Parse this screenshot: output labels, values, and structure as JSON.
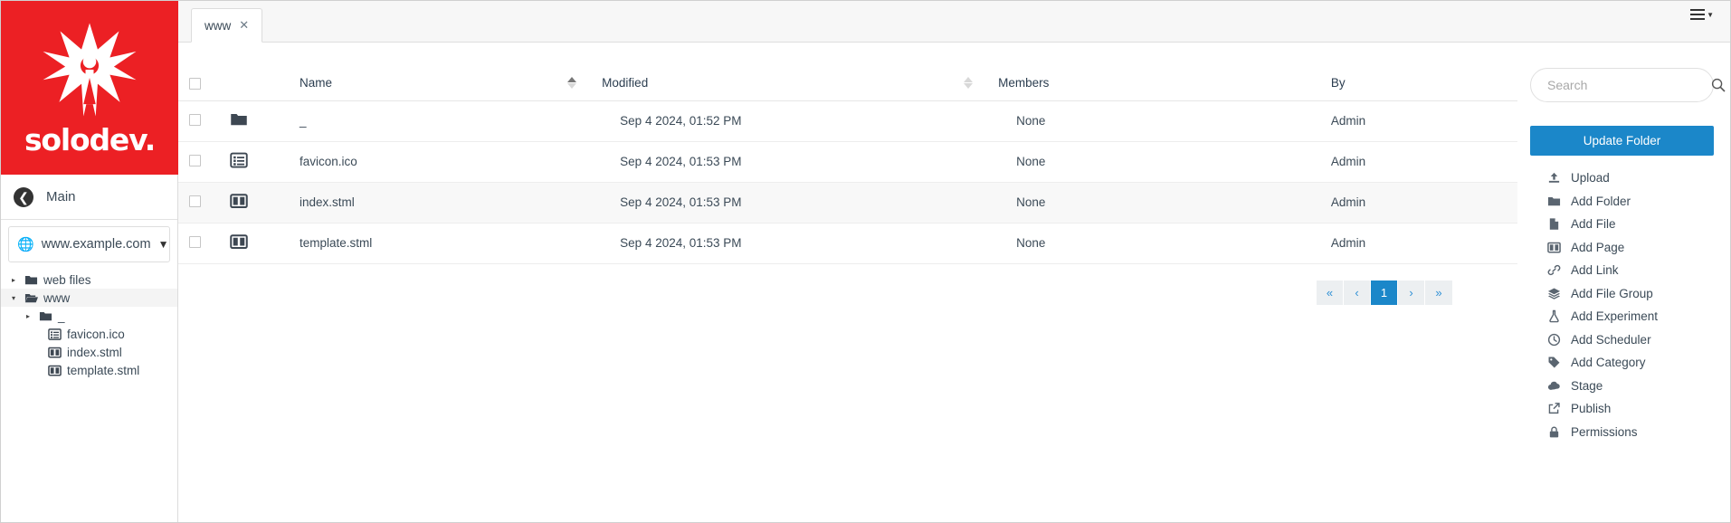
{
  "brand": {
    "name": "solodev.",
    "color": "#ec2024",
    "logo_icon": "solodev-star-logo"
  },
  "sidebar": {
    "back_label": "Main",
    "back_icon": "back-arrow-icon",
    "site": {
      "name": "www.example.com",
      "icon": "globe-icon",
      "caret_icon": "chevron-down-icon"
    },
    "tree": [
      {
        "label": "web files",
        "icon": "folder-closed-icon",
        "toggle": "▸",
        "expanded": false,
        "indent": 1,
        "selected": false
      },
      {
        "label": "www",
        "icon": "folder-open-icon",
        "toggle": "▾",
        "expanded": true,
        "indent": 1,
        "selected": true
      },
      {
        "label": "_",
        "icon": "folder-closed-icon",
        "toggle": "▸",
        "expanded": false,
        "indent": 2,
        "selected": false
      },
      {
        "label": "favicon.ico",
        "icon": "file-list-icon",
        "toggle": "",
        "expanded": false,
        "indent": 3,
        "selected": false
      },
      {
        "label": "index.stml",
        "icon": "file-columns-icon",
        "toggle": "",
        "expanded": false,
        "indent": 3,
        "selected": false
      },
      {
        "label": "template.stml",
        "icon": "file-columns-icon",
        "toggle": "",
        "expanded": false,
        "indent": 3,
        "selected": false
      }
    ]
  },
  "tabs": [
    {
      "label": "www",
      "close_icon": "close-icon",
      "active": true
    }
  ],
  "topbar": {
    "menu_icon": "hamburger-menu-icon",
    "menu_caret_icon": "caret-down-icon"
  },
  "search": {
    "placeholder": "Search",
    "value": "",
    "icon": "search-icon"
  },
  "table": {
    "columns": [
      {
        "key": "checkbox",
        "label": "",
        "sortable": false,
        "sort": "none"
      },
      {
        "key": "icon",
        "label": "",
        "sortable": false,
        "sort": "none"
      },
      {
        "key": "name",
        "label": "Name",
        "sortable": true,
        "sort": "none"
      },
      {
        "key": "modified",
        "label": "Modified",
        "sortable": true,
        "sort": "asc"
      },
      {
        "key": "members",
        "label": "Members",
        "sortable": true,
        "sort": "none"
      },
      {
        "key": "by",
        "label": "By",
        "sortable": false,
        "sort": "none"
      }
    ],
    "rows": [
      {
        "icon": "folder-closed-icon",
        "name": "_",
        "modified": "Sep 4 2024, 01:52 PM",
        "members": "None",
        "by": "Admin",
        "highlighted": false
      },
      {
        "icon": "file-list-icon",
        "name": "favicon.ico",
        "modified": "Sep 4 2024, 01:53 PM",
        "members": "None",
        "by": "Admin",
        "highlighted": false
      },
      {
        "icon": "file-columns-icon",
        "name": "index.stml",
        "modified": "Sep 4 2024, 01:53 PM",
        "members": "None",
        "by": "Admin",
        "highlighted": true
      },
      {
        "icon": "file-columns-icon",
        "name": "template.stml",
        "modified": "Sep 4 2024, 01:53 PM",
        "members": "None",
        "by": "Admin",
        "highlighted": false
      }
    ]
  },
  "pagination": {
    "first_label": "«",
    "prev_label": "‹",
    "pages": [
      "1"
    ],
    "current_page": "1",
    "next_label": "›",
    "last_label": "»",
    "active_color": "#1b87c9"
  },
  "right_panel": {
    "primary_button": {
      "label": "Update Folder",
      "color": "#1b87c9"
    },
    "actions": [
      {
        "label": "Upload",
        "icon": "upload-icon"
      },
      {
        "label": "Add Folder",
        "icon": "folder-icon"
      },
      {
        "label": "Add File",
        "icon": "file-icon"
      },
      {
        "label": "Add Page",
        "icon": "page-columns-icon"
      },
      {
        "label": "Add Link",
        "icon": "link-icon"
      },
      {
        "label": "Add File Group",
        "icon": "layers-icon"
      },
      {
        "label": "Add Experiment",
        "icon": "flask-icon"
      },
      {
        "label": "Add Scheduler",
        "icon": "clock-icon"
      },
      {
        "label": "Add Category",
        "icon": "tag-icon"
      },
      {
        "label": "Stage",
        "icon": "cloud-upload-icon"
      },
      {
        "label": "Publish",
        "icon": "publish-icon"
      },
      {
        "label": "Permissions",
        "icon": "lock-icon"
      }
    ]
  }
}
